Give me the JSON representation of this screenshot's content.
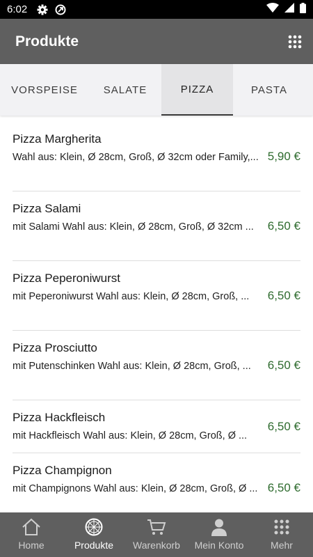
{
  "status_bar": {
    "time": "6:02"
  },
  "app_bar": {
    "title": "Produkte"
  },
  "tabs": [
    {
      "label": "VORSPEISE"
    },
    {
      "label": "SALATE"
    },
    {
      "label": "PIZZA",
      "active": true
    },
    {
      "label": "PASTA"
    }
  ],
  "products": [
    {
      "name": "Pizza Margherita",
      "description": "Wahl aus: Klein, Ø 28cm, Groß, Ø 32cm oder Family,...",
      "price": "5,90 €"
    },
    {
      "name": "Pizza Salami",
      "description": "mit Salami Wahl aus: Klein, Ø 28cm, Groß, Ø 32cm ...",
      "price": "6,50 €"
    },
    {
      "name": "Pizza Peperoniwurst",
      "description": "mit Peperoniwurst Wahl aus: Klein, Ø 28cm, Groß, ...",
      "price": "6,50 €"
    },
    {
      "name": "Pizza Prosciutto",
      "description": "mit Putenschinken Wahl aus: Klein, Ø 28cm, Groß, ...",
      "price": "6,50 €"
    },
    {
      "name": "Pizza Hackfleisch",
      "description": "mit Hackfleisch Wahl aus: Klein, Ø 28cm, Groß, Ø ...",
      "price": "6,50 €"
    },
    {
      "name": "Pizza Champignon",
      "description": "mit Champignons Wahl aus: Klein, Ø 28cm, Groß, Ø ...",
      "price": "6,50 €"
    }
  ],
  "bottom_nav": [
    {
      "label": "Home",
      "icon": "home-icon"
    },
    {
      "label": "Produkte",
      "icon": "pizza-icon",
      "active": true
    },
    {
      "label": "Warenkorb",
      "icon": "cart-icon"
    },
    {
      "label": "Mein Konto",
      "icon": "person-icon"
    },
    {
      "label": "Mehr",
      "icon": "grid-icon"
    }
  ],
  "colors": {
    "app_bar": "#5f5f5f",
    "price": "#2e6b2e",
    "tab_bar": "#f2f2f4"
  }
}
